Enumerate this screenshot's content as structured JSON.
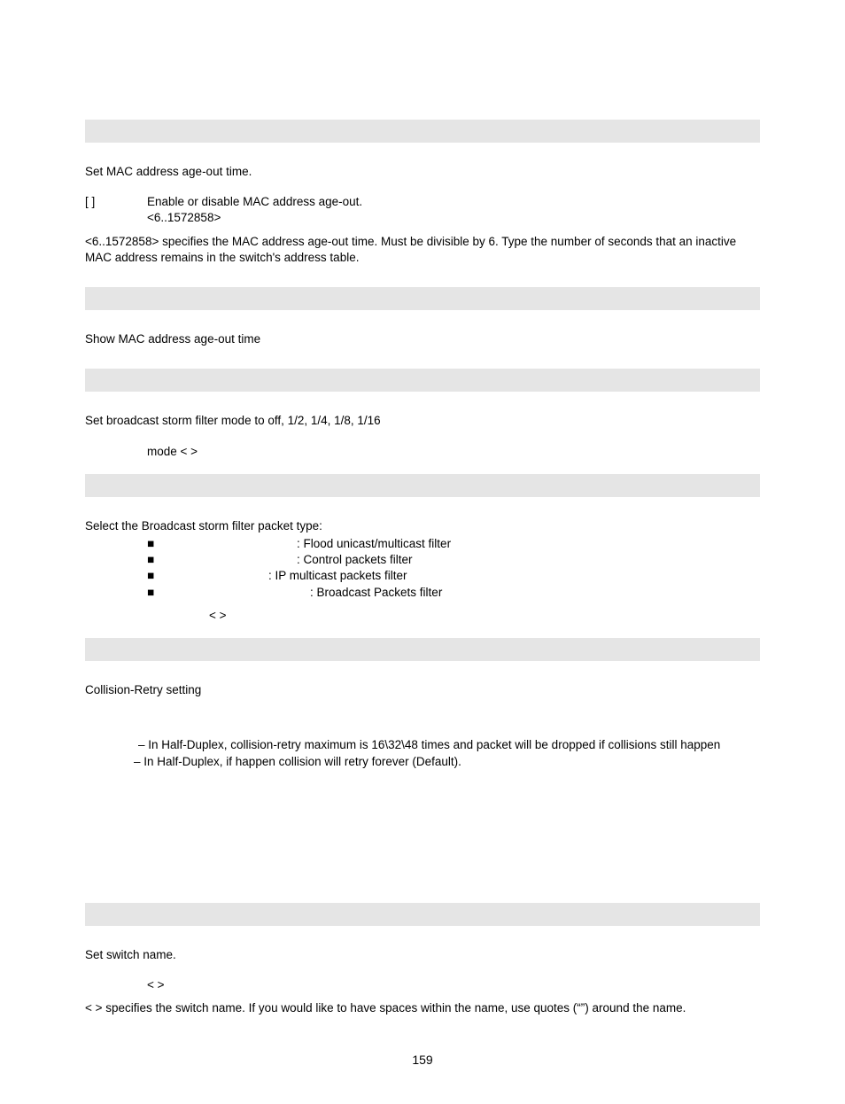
{
  "s1": {
    "desc": "Set MAC address age-out time.",
    "line1_a": "[   ]",
    "line1_b": "Enable or disable MAC address age-out.",
    "line2": "<6..1572858>",
    "note": "<6..1572858> specifies the MAC address age-out time. Must be divisible by 6. Type the number of seconds that an inactive MAC address remains in the switch's address table."
  },
  "s2": {
    "desc": "Show MAC address age-out time"
  },
  "s3": {
    "desc": "Set broadcast storm filter mode to off, 1/2, 1/4, 1/8, 1/16",
    "line": "mode <                                          >"
  },
  "s4": {
    "desc": "Select the Broadcast storm filter packet type:",
    "items": [
      ": Flood unicast/multicast filter",
      ": Control packets filter",
      ": IP multicast packets filter",
      ": Broadcast Packets filter"
    ],
    "tail": "<                                                                                                                >"
  },
  "s5": {
    "desc": "Collision-Retry setting",
    "l1": " – In Half-Duplex, collision-retry maximum is 16\\32\\48 times and packet will be dropped if collisions still happen",
    "l2": "– In Half-Duplex, if happen collision will retry forever (Default)."
  },
  "s6": {
    "desc": "Set switch name.",
    "line": "<              >",
    "note": "<               > specifies the switch name. If you would like to have spaces within the name, use quotes (“”) around the name."
  },
  "pagenum": "159"
}
